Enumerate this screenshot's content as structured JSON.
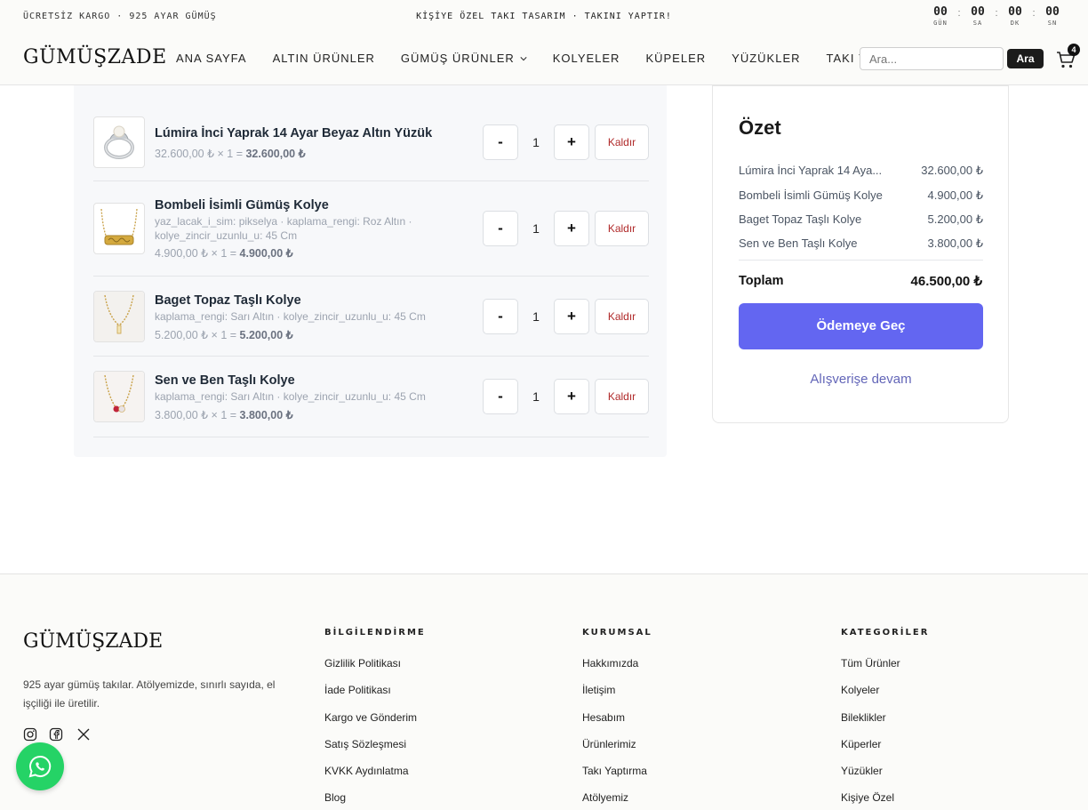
{
  "topbar": {
    "left_text": "ÜCRETSİZ KARGO · 925 AYAR GÜMÜŞ",
    "center_text": "KİŞİYE ÖZEL TAKI TASARIM · TAKINI YAPTIR!",
    "countdown": [
      {
        "value": "00",
        "label": "GÜN"
      },
      {
        "value": "00",
        "label": "SA"
      },
      {
        "value": "00",
        "label": "DK"
      },
      {
        "value": "00",
        "label": "SN"
      }
    ],
    "separator": ":"
  },
  "header": {
    "logo": "GÜMÜŞZADE",
    "nav": [
      {
        "label": "ANA SAYFA"
      },
      {
        "label": "ALTIN ÜRÜNLER"
      },
      {
        "label": "GÜMÜŞ ÜRÜNLER",
        "has_dropdown": true
      },
      {
        "label": "KOLYELER"
      },
      {
        "label": "KÜPELER"
      },
      {
        "label": "YÜZÜKLER"
      },
      {
        "label": "TAKI YAPTIRMA"
      }
    ],
    "search_placeholder": "Ara...",
    "search_button": "Ara",
    "cart_count": "4"
  },
  "cart": {
    "items": [
      {
        "title": "Lúmira İnci Yaprak 14 Ayar Beyaz Altın Yüzük",
        "meta_lines": [],
        "price_prefix": "32.600,00 ₺ × 1 = ",
        "price_total": "32.600,00 ₺",
        "qty": "1",
        "thumb_icon": "ring-icon"
      },
      {
        "title": "Bombeli İsimli Gümüş Kolye",
        "meta_lines": [
          "yaz_lacak_i_sim: pikselya · kaplama_rengi: Roz Altın ·",
          "kolye_zincir_uzunlu_u: 45 Cm"
        ],
        "price_prefix": "4.900,00 ₺ × 1 = ",
        "price_total": "4.900,00 ₺",
        "qty": "1",
        "thumb_icon": "name-necklace-icon"
      },
      {
        "title": "Baget Topaz Taşlı Kolye",
        "meta_lines": [
          "kaplama_rengi: Sarı Altın · kolye_zincir_uzunlu_u: 45 Cm"
        ],
        "price_prefix": "5.200,00 ₺ × 1 = ",
        "price_total": "5.200,00 ₺",
        "qty": "1",
        "thumb_icon": "pendant-necklace-icon"
      },
      {
        "title": "Sen ve Ben Taşlı Kolye",
        "meta_lines": [
          "kaplama_rengi: Sarı Altın · kolye_zincir_uzunlu_u: 45 Cm"
        ],
        "price_prefix": "3.800,00 ₺ × 1 = ",
        "price_total": "3.800,00 ₺",
        "qty": "1",
        "thumb_icon": "stone-necklace-icon"
      }
    ],
    "minus_label": "-",
    "plus_label": "+",
    "remove_label": "Kaldır"
  },
  "summary": {
    "title": "Özet",
    "rows": [
      {
        "name": "Lúmira İnci Yaprak 14 Aya...",
        "price": "32.600,00 ₺"
      },
      {
        "name": "Bombeli İsimli Gümüş Kolye",
        "price": "4.900,00 ₺"
      },
      {
        "name": "Baget Topaz Taşlı Kolye",
        "price": "5.200,00 ₺"
      },
      {
        "name": "Sen ve Ben Taşlı Kolye",
        "price": "3.800,00 ₺"
      }
    ],
    "total_label": "Toplam",
    "total_value": "46.500,00 ₺",
    "checkout_label": "Ödemeye Geç",
    "continue_label": "Alışverişe devam",
    "accent_color": "#6366f1"
  },
  "footer": {
    "logo": "GÜMÜŞZADE",
    "description": "925 ayar gümüş takılar. Atölyemizde, sınırlı sayıda, el işçiliği ile üretilir.",
    "social": [
      "instagram-icon",
      "facebook-icon",
      "x-icon"
    ],
    "columns": [
      {
        "title": "BİLGİLENDİRME",
        "links": [
          "Gizlilik Politikası",
          "İade Politikası",
          "Kargo ve Gönderim",
          "Satış Sözleşmesi",
          "KVKK Aydınlatma",
          "Blog"
        ]
      },
      {
        "title": "KURUMSAL",
        "links": [
          "Hakkımızda",
          "İletişim",
          "Hesabım",
          "Ürünlerimiz",
          "Takı Yaptırma",
          "Atölyemiz"
        ]
      },
      {
        "title": "KATEGORİLER",
        "links": [
          "Tüm Ürünler",
          "Kolyeler",
          "Bileklikler",
          "Küperler",
          "Yüzükler",
          "Kişiye Özel"
        ]
      }
    ],
    "whatsapp_icon": "whatsapp-icon"
  }
}
